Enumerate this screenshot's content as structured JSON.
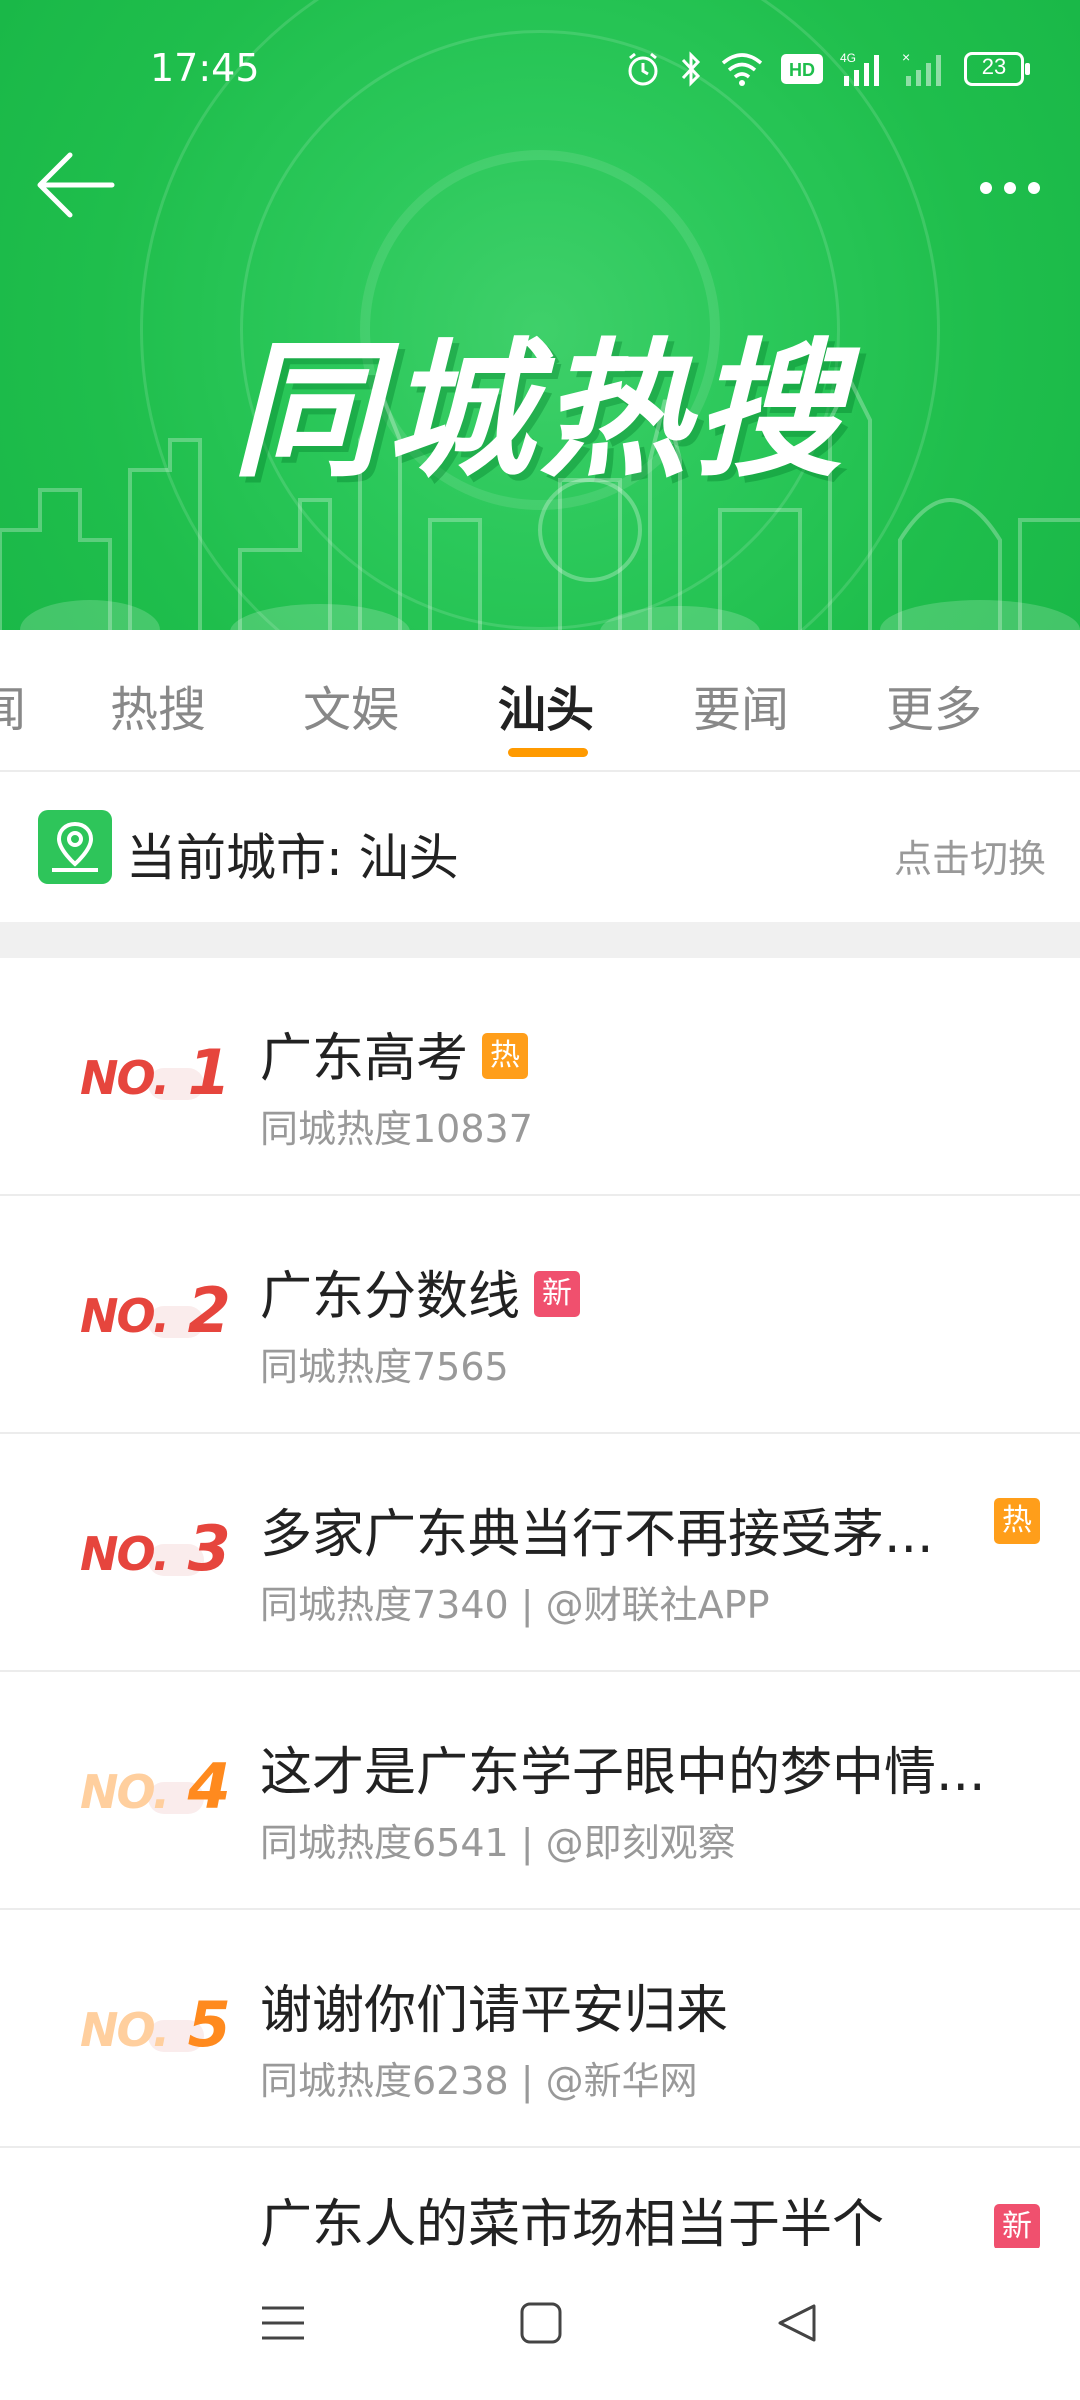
{
  "status": {
    "time": "17:45",
    "battery": "23"
  },
  "header": {
    "title": "同城热搜",
    "more_label": "•••"
  },
  "tabs": [
    {
      "label": "闻",
      "active": false
    },
    {
      "label": "热搜",
      "active": false
    },
    {
      "label": "文娱",
      "active": false
    },
    {
      "label": "汕头",
      "active": true
    },
    {
      "label": "要闻",
      "active": false
    },
    {
      "label": "更多",
      "active": false
    }
  ],
  "city": {
    "label": "当前城市: 汕头",
    "switch_label": "点击切换"
  },
  "list": [
    {
      "rank_prefix": "NO.",
      "rank_num": "1",
      "title": "广东高考",
      "badge": "热",
      "badge_color": "#ff9e1a",
      "sub": "同城热度10837",
      "rank_color": "#e6453d"
    },
    {
      "rank_prefix": "NO.",
      "rank_num": "2",
      "title": "广东分数线",
      "badge": "新",
      "badge_color": "#f0506e",
      "sub": "同城热度7565",
      "rank_color": "#e6453d"
    },
    {
      "rank_prefix": "NO.",
      "rank_num": "3",
      "title": "多家广东典当行不再接受茅...",
      "badge": "热",
      "badge_color": "#ff9e1a",
      "sub": "同城热度7340 | @财联社APP",
      "rank_color": "#e6453d"
    },
    {
      "rank_prefix": "NO.",
      "rank_num": "4",
      "title": "这才是广东学子眼中的梦中情...",
      "badge": "",
      "badge_color": "",
      "sub": "同城热度6541 | @即刻观察",
      "rank_color": "#ff8a1e"
    },
    {
      "rank_prefix": "NO.",
      "rank_num": "5",
      "title": "谢谢你们请平安归来",
      "badge": "",
      "badge_color": "",
      "sub": "同城热度6238 | @新华网",
      "rank_color": "#ff8a1e"
    },
    {
      "rank_prefix": "",
      "rank_num": "",
      "title": "广东人的菜市场相当于半个",
      "badge": "新",
      "badge_color": "#f0506e",
      "sub": "",
      "rank_color": "#ffb347"
    }
  ],
  "colors": {
    "header_green": "#2bc85a",
    "tab_indicator": "#ff9a00",
    "divider": "#ececec"
  }
}
